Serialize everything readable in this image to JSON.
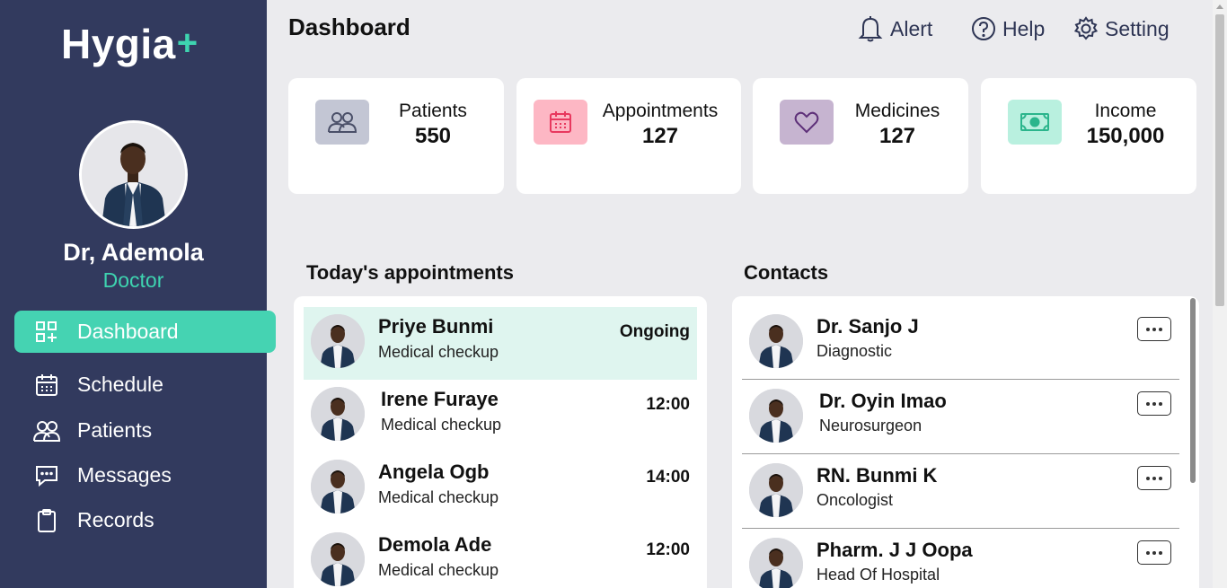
{
  "brand": {
    "name": "Hygia",
    "plus": "+"
  },
  "user": {
    "name": "Dr, Ademola",
    "role": "Doctor"
  },
  "nav": [
    {
      "label": "Dashboard",
      "icon": "dashboard-icon"
    },
    {
      "label": "Schedule",
      "icon": "calendar-icon"
    },
    {
      "label": "Patients",
      "icon": "users-icon"
    },
    {
      "label": "Messages",
      "icon": "message-icon"
    },
    {
      "label": "Records",
      "icon": "clipboard-icon"
    }
  ],
  "header": {
    "title": "Dashboard",
    "alert": "Alert",
    "help": "Help",
    "setting": "Setting"
  },
  "stats": [
    {
      "label": "Patients",
      "value": "550",
      "icon": "users-icon",
      "color": "#c3c6d4"
    },
    {
      "label": "Appointments",
      "value": "127",
      "icon": "calendar-icon",
      "color": "#fdb7c4"
    },
    {
      "label": "Medicines",
      "value": "127",
      "icon": "heart-icon",
      "color": "#c6b4d0"
    },
    {
      "label": "Income",
      "value": "150,000",
      "icon": "cash-icon",
      "color": "#b9f0df"
    }
  ],
  "appointments": {
    "title": "Today's appointments",
    "items": [
      {
        "name": "Priye Bunmi",
        "type": "Medical checkup",
        "time": "Ongoing"
      },
      {
        "name": "Irene Furaye",
        "type": "Medical checkup",
        "time": "12:00"
      },
      {
        "name": "Angela Ogb",
        "type": "Medical checkup",
        "time": "14:00"
      },
      {
        "name": "Demola Ade",
        "type": "Medical checkup",
        "time": "12:00"
      }
    ]
  },
  "contacts": {
    "title": "Contacts",
    "items": [
      {
        "name": "Dr. Sanjo J",
        "role": "Diagnostic"
      },
      {
        "name": "Dr. Oyin Imao",
        "role": "Neurosurgeon"
      },
      {
        "name": "RN. Bunmi K",
        "role": "Oncologist"
      },
      {
        "name": "Pharm. J J Oopa",
        "role": "Head Of Hospital"
      }
    ]
  },
  "colors": {
    "sidebar": "#323a5e",
    "accent": "#45d3b2",
    "background": "#ebebee"
  }
}
